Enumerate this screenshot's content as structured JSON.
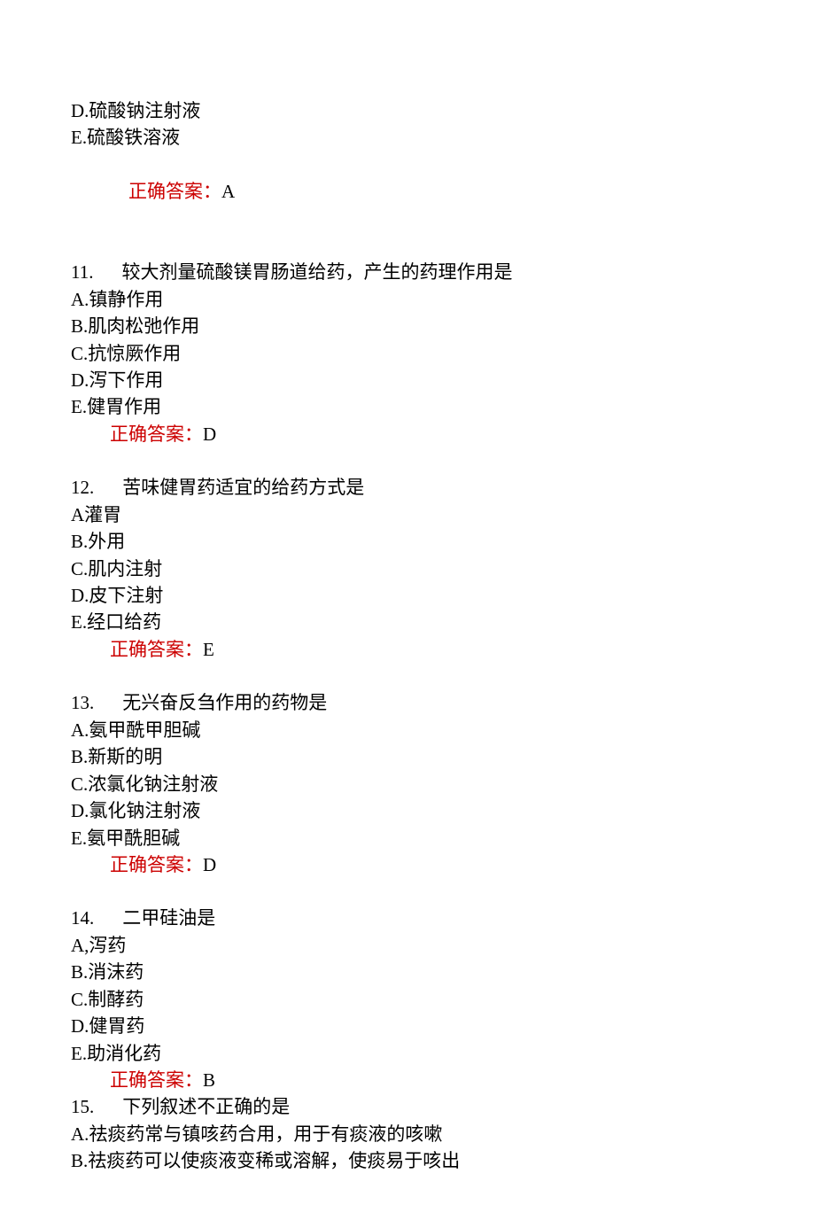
{
  "leading": {
    "opt_d": "D.硫酸钠注射液",
    "opt_e": "E.硫酸铁溶液",
    "answer_label": "正确答案：",
    "answer_value": "A"
  },
  "questions": [
    {
      "num": "11.",
      "text": "较大剂量硫酸镁胃肠道给药，产生的药理作用是",
      "opts": [
        "A.镇静作用",
        "B.肌肉松弛作用",
        "C.抗惊厥作用",
        "D.泻下作用",
        "E.健胃作用"
      ],
      "answer_label": "正确答案：",
      "answer_value": "D",
      "blank_before": true
    },
    {
      "num": "12.",
      "text": "苦味健胃药适宜的给药方式是",
      "opts": [
        "A灌胃",
        "B.外用",
        "C.肌内注射",
        "D.皮下注射",
        "E.经口给药"
      ],
      "answer_label": "正确答案：",
      "answer_value": "E",
      "blank_before": true
    },
    {
      "num": "13.",
      "text": "无兴奋反刍作用的药物是",
      "opts": [
        "A.氨甲酰甲胆碱",
        "B.新斯的明",
        "C.浓氯化钠注射液",
        "D.氯化钠注射液",
        "E.氨甲酰胆碱"
      ],
      "answer_label": "正确答案：",
      "answer_value": "D",
      "blank_before": true
    },
    {
      "num": "14.",
      "text": "二甲硅油是",
      "opts": [
        "A,泻药",
        "B.消沫药",
        "C.制酵药",
        "D.健胃药",
        "E.助消化药"
      ],
      "answer_label": "正确答案：",
      "answer_value": "B",
      "blank_before": true
    },
    {
      "num": "15.",
      "text": "下列叙述不正确的是",
      "opts": [
        "A.祛痰药常与镇咳药合用，用于有痰液的咳嗽",
        "B.祛痰药可以使痰液变稀或溶解，使痰易于咳出"
      ],
      "answer_label": null,
      "answer_value": null,
      "blank_before": false
    }
  ]
}
